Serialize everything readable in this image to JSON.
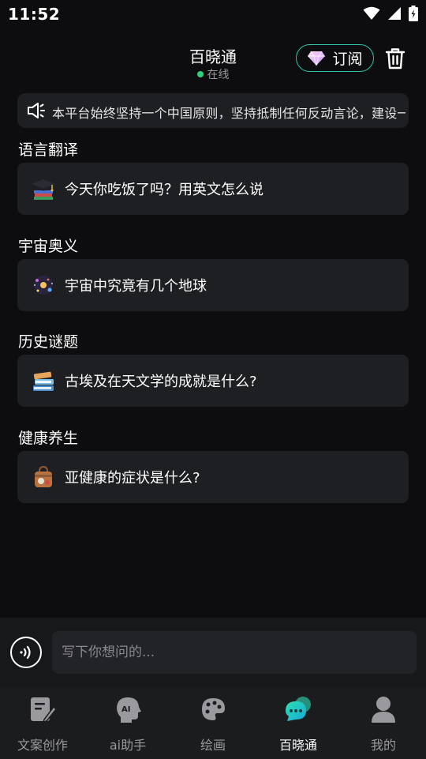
{
  "status_bar": {
    "time": "11:52"
  },
  "header": {
    "title": "百晓通",
    "status": "在线",
    "subscribe_label": "订阅"
  },
  "notice": {
    "text": "本平台始终坚持一个中国原则，坚持抵制任何反动言论，建设一"
  },
  "sections": [
    {
      "title": "语言翻译",
      "question": "今天你吃饭了吗？用英文怎么说",
      "icon": "graduation-cap-icon"
    },
    {
      "title": "宇宙奥义",
      "question": "宇宙中究竟有几个地球",
      "icon": "galaxy-icon"
    },
    {
      "title": "历史谜题",
      "question": "古埃及在天文学的成就是什么?",
      "icon": "books-icon"
    },
    {
      "title": "健康养生",
      "question": "亚健康的症状是什么?",
      "icon": "medicine-bag-icon"
    }
  ],
  "input": {
    "placeholder": "写下你想问的..."
  },
  "nav": {
    "items": [
      {
        "label": "文案创作",
        "icon": "document-edit-icon",
        "active": false
      },
      {
        "label": "ai助手",
        "icon": "ai-head-icon",
        "active": false
      },
      {
        "label": "绘画",
        "icon": "palette-icon",
        "active": false
      },
      {
        "label": "百晓通",
        "icon": "chat-bubble-icon",
        "active": true
      },
      {
        "label": "我的",
        "icon": "user-icon",
        "active": false
      }
    ]
  },
  "colors": {
    "background": "#0d0d0f",
    "card": "#1e1f22",
    "accent": "#2bc4a8",
    "online": "#2fd07a",
    "active_nav": "#1ec8c0"
  }
}
